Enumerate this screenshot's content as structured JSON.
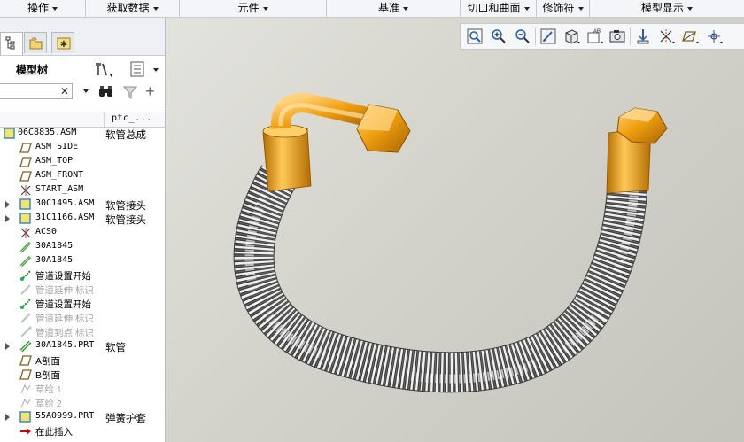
{
  "menubar": {
    "items": [
      {
        "label": "操作"
      },
      {
        "label": "获取数据"
      },
      {
        "label": "元件"
      },
      {
        "label": "基准"
      },
      {
        "label": "切口和曲面"
      },
      {
        "label": "修饰符"
      },
      {
        "label": "模型显示"
      }
    ]
  },
  "left_panel": {
    "tabs": [
      {
        "icon": "model-tree-tab-icon"
      },
      {
        "icon": "folder-browser-tab-icon"
      },
      {
        "icon": "favorites-tab-icon"
      }
    ],
    "tree_title": "模型树",
    "search": {
      "value": "",
      "clear": "✕"
    },
    "columns": {
      "name": "",
      "param": "ptc_..."
    },
    "rows": [
      {
        "label": "06C8835.ASM",
        "param": "软管总成",
        "icon": "assembly-icon",
        "expander": false
      },
      {
        "label": "ASM_SIDE",
        "param": "",
        "icon": "datum-plane-icon",
        "expander": false
      },
      {
        "label": "ASM_TOP",
        "param": "",
        "icon": "datum-plane-icon",
        "expander": false
      },
      {
        "label": "ASM_FRONT",
        "param": "",
        "icon": "datum-plane-icon",
        "expander": false
      },
      {
        "label": "START_ASM",
        "param": "",
        "icon": "coordinate-system-icon",
        "expander": false
      },
      {
        "label": "30C1495.ASM",
        "param": "软管接头",
        "icon": "assembly-icon",
        "expander": true
      },
      {
        "label": "31C1166.ASM",
        "param": "软管接头",
        "icon": "assembly-icon",
        "expander": true
      },
      {
        "label": "ACS0",
        "param": "",
        "icon": "coordinate-system-icon",
        "expander": false
      },
      {
        "label": "30A1845",
        "param": "",
        "icon": "pipe-segment-icon",
        "expander": false
      },
      {
        "label": "30A1845",
        "param": "",
        "icon": "pipe-segment-icon",
        "expander": false
      },
      {
        "label": "管道设置开始",
        "param": "",
        "icon": "route-start-icon",
        "expander": false
      },
      {
        "label": "管道延伸 标识",
        "param": "",
        "icon": "route-extend-icon",
        "expander": false,
        "dim": true
      },
      {
        "label": "管道设置开始",
        "param": "",
        "icon": "route-start-icon",
        "expander": false
      },
      {
        "label": "管道延伸 标识",
        "param": "",
        "icon": "route-extend-icon",
        "expander": false,
        "dim": true
      },
      {
        "label": "管道到点 标识",
        "param": "",
        "icon": "route-to-point-icon",
        "expander": false,
        "dim": true
      },
      {
        "label": "30A1845.PRT",
        "param": "软管",
        "icon": "part-icon",
        "expander": true
      },
      {
        "label": "A剖面",
        "param": "",
        "icon": "cross-section-icon",
        "expander": false
      },
      {
        "label": "B剖面",
        "param": "",
        "icon": "cross-section-icon",
        "expander": false
      },
      {
        "label": "草绘 1",
        "param": "",
        "icon": "sketch-icon",
        "expander": false,
        "dim": true
      },
      {
        "label": "草绘 2",
        "param": "",
        "icon": "sketch-icon",
        "expander": false,
        "dim": true
      },
      {
        "label": "55A0999.PRT",
        "param": "弹簧护套",
        "icon": "assembly-icon",
        "expander": true
      },
      {
        "label": "在此插入",
        "param": "",
        "icon": "insert-here-arrow-icon",
        "expander": false
      }
    ]
  },
  "view_toolbar": {
    "buttons": [
      {
        "name": "refit-icon"
      },
      {
        "name": "zoom-in-icon"
      },
      {
        "name": "zoom-out-icon"
      },
      {
        "name": "repaint-icon"
      },
      {
        "name": "shading-style-icon"
      },
      {
        "name": "saved-views-icon"
      },
      {
        "name": "view-manager-icon"
      },
      {
        "name": "datum-display-icon"
      },
      {
        "name": "datum-axes-icon"
      },
      {
        "name": "datum-planes-icon"
      },
      {
        "name": "spin-center-icon"
      }
    ]
  },
  "colors": {
    "fitting_orange": "#f0a010",
    "spring_silver": "#e8e8e8",
    "background": "#d6d6cf"
  }
}
